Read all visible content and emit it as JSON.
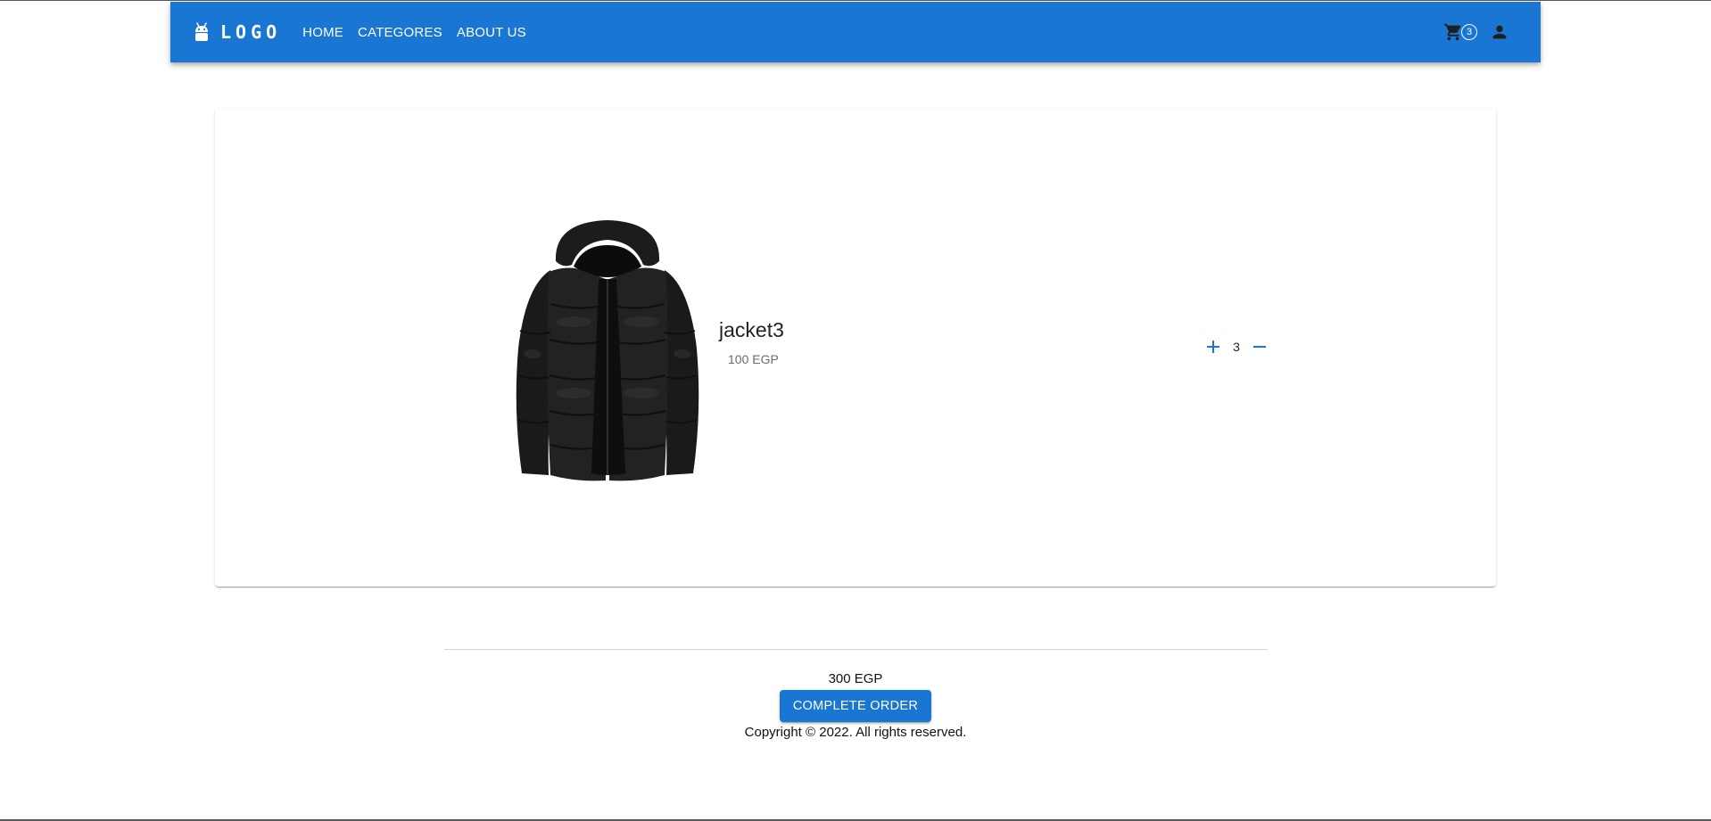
{
  "header": {
    "logo_text": "LOGO",
    "logo_icon": "android-icon",
    "nav": [
      {
        "label": "HOME"
      },
      {
        "label": "CATEGORES"
      },
      {
        "label": "ABOUT US"
      }
    ],
    "cart_icon": "cart-icon",
    "cart_count": "3",
    "account_icon": "person-icon"
  },
  "cart": {
    "items": [
      {
        "name": "jacket3",
        "price": "100 EGP",
        "quantity": "3",
        "image": "black puffer jacket"
      }
    ]
  },
  "summary": {
    "total": "300 EGP",
    "order_button": "COMPLETE ORDER",
    "copyright": "Copyright © 2022. All rights reserved."
  },
  "colors": {
    "primary": "#1976d2",
    "text": "#222222",
    "muted": "#6b6b6b"
  }
}
